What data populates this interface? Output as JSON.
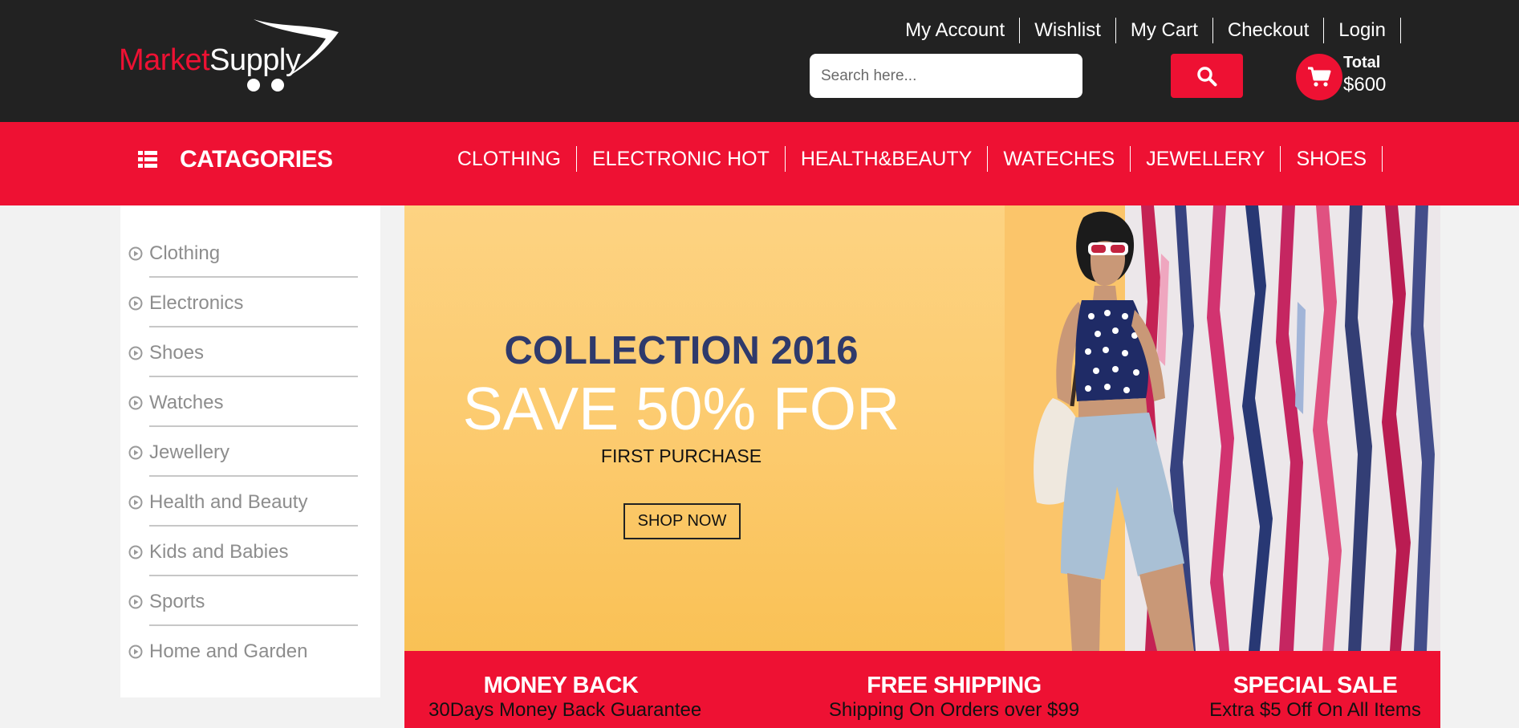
{
  "brand": {
    "part1": "Market",
    "part2": "Supply"
  },
  "header": {
    "links": [
      "My Account",
      "Wishlist",
      "My Cart",
      "Checkout",
      "Login"
    ],
    "search_placeholder": "Search here...",
    "cart": {
      "total_label": "Total",
      "total_value": "$600"
    }
  },
  "nav": {
    "categories_label": "CATAGORIES",
    "items": [
      "CLOTHING",
      "ELECTRONIC HOT",
      "HEALTH&BEAUTY",
      "WATECHES",
      "JEWELLERY",
      "SHOES"
    ]
  },
  "sidebar": {
    "items": [
      "Clothing",
      "Electronics",
      "Shoes",
      "Watches",
      "Jewellery",
      "Health and Beauty",
      "Kids and Babies",
      "Sports",
      "Home and Garden"
    ]
  },
  "banner": {
    "title": "COLLECTION 2016",
    "headline": "SAVE 50% FOR",
    "subline": "FIRST PURCHASE",
    "cta": "SHOP NOW"
  },
  "features": [
    {
      "title": "MONEY BACK",
      "desc": "30Days Money Back Guarantee"
    },
    {
      "title": "FREE SHIPPING",
      "desc": "Shipping On Orders over $99"
    },
    {
      "title": "SPECIAL SALE",
      "desc": "Extra $5 Off On All Items"
    }
  ],
  "colors": {
    "accent": "#ee1133",
    "dark": "#222222",
    "banner_bg": "#fcca6d",
    "title_navy": "#2f3a6b"
  }
}
